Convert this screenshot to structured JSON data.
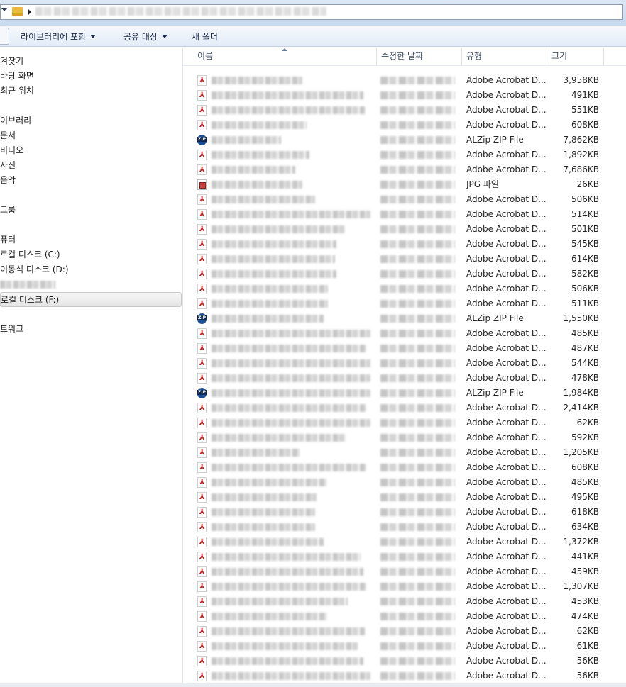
{
  "addressbar": {
    "icon": "folder-icon"
  },
  "toolbar": {
    "include_in_library": "라이브러리에 포함",
    "share_with": "공유 대상",
    "new_folder": "새 폴더"
  },
  "nav": {
    "items": [
      {
        "label": "겨찾기",
        "top": 0
      },
      {
        "label": "바탕 화면",
        "top": 0
      },
      {
        "label": "최근 위치",
        "top": 0
      },
      {
        "label": "이브러리",
        "top": 0
      },
      {
        "label": "문서",
        "top": 0
      },
      {
        "label": "비디오",
        "top": 0
      },
      {
        "label": "사진",
        "top": 0
      },
      {
        "label": "음악",
        "top": 0
      },
      {
        "label": "그룹",
        "top": 0
      },
      {
        "label": "퓨터",
        "top": 0
      },
      {
        "label": "로컬 디스크 (C:)",
        "top": 0
      },
      {
        "label": "이동식 디스크 (D:)",
        "top": 0
      },
      {
        "label": "",
        "top": 0
      },
      {
        "label": "로컬 디스크 (F:)",
        "top": 0
      },
      {
        "label": "트워크",
        "top": 0
      }
    ]
  },
  "columns": {
    "name": "이름",
    "date": "수정한 날짜",
    "type": "유형",
    "size": "크기"
  },
  "files": [
    {
      "icon": "pdf",
      "type": "Adobe Acrobat D...",
      "size": "3,958KB"
    },
    {
      "icon": "pdf",
      "type": "Adobe Acrobat D...",
      "size": "491KB"
    },
    {
      "icon": "pdf",
      "type": "Adobe Acrobat D...",
      "size": "551KB"
    },
    {
      "icon": "pdf",
      "type": "Adobe Acrobat D...",
      "size": "608KB"
    },
    {
      "icon": "zip",
      "type": "ALZip ZIP File",
      "size": "7,862KB"
    },
    {
      "icon": "pdf",
      "type": "Adobe Acrobat D...",
      "size": "1,892KB"
    },
    {
      "icon": "pdf",
      "type": "Adobe Acrobat D...",
      "size": "7,686KB"
    },
    {
      "icon": "jpg",
      "type": "JPG 파일",
      "size": "26KB"
    },
    {
      "icon": "pdf",
      "type": "Adobe Acrobat D...",
      "size": "506KB"
    },
    {
      "icon": "pdf",
      "type": "Adobe Acrobat D...",
      "size": "514KB"
    },
    {
      "icon": "pdf",
      "type": "Adobe Acrobat D...",
      "size": "501KB"
    },
    {
      "icon": "pdf",
      "type": "Adobe Acrobat D...",
      "size": "545KB"
    },
    {
      "icon": "pdf",
      "type": "Adobe Acrobat D...",
      "size": "614KB"
    },
    {
      "icon": "pdf",
      "type": "Adobe Acrobat D...",
      "size": "582KB"
    },
    {
      "icon": "pdf",
      "type": "Adobe Acrobat D...",
      "size": "506KB"
    },
    {
      "icon": "pdf",
      "type": "Adobe Acrobat D...",
      "size": "511KB"
    },
    {
      "icon": "zip",
      "type": "ALZip ZIP File",
      "size": "1,550KB"
    },
    {
      "icon": "pdf",
      "type": "Adobe Acrobat D...",
      "size": "485KB"
    },
    {
      "icon": "pdf",
      "type": "Adobe Acrobat D...",
      "size": "487KB"
    },
    {
      "icon": "pdf",
      "type": "Adobe Acrobat D...",
      "size": "544KB"
    },
    {
      "icon": "pdf",
      "type": "Adobe Acrobat D...",
      "size": "478KB"
    },
    {
      "icon": "zip",
      "type": "ALZip ZIP File",
      "size": "1,984KB"
    },
    {
      "icon": "pdf",
      "type": "Adobe Acrobat D...",
      "size": "2,414KB"
    },
    {
      "icon": "pdf",
      "type": "Adobe Acrobat D...",
      "size": "62KB"
    },
    {
      "icon": "pdf",
      "type": "Adobe Acrobat D...",
      "size": "592KB"
    },
    {
      "icon": "pdf",
      "type": "Adobe Acrobat D...",
      "size": "1,205KB"
    },
    {
      "icon": "pdf",
      "type": "Adobe Acrobat D...",
      "size": "608KB"
    },
    {
      "icon": "pdf",
      "type": "Adobe Acrobat D...",
      "size": "485KB"
    },
    {
      "icon": "pdf",
      "type": "Adobe Acrobat D...",
      "size": "495KB"
    },
    {
      "icon": "pdf",
      "type": "Adobe Acrobat D...",
      "size": "618KB"
    },
    {
      "icon": "pdf",
      "type": "Adobe Acrobat D...",
      "size": "634KB"
    },
    {
      "icon": "pdf",
      "type": "Adobe Acrobat D...",
      "size": "1,372KB"
    },
    {
      "icon": "pdf",
      "type": "Adobe Acrobat D...",
      "size": "441KB"
    },
    {
      "icon": "pdf",
      "type": "Adobe Acrobat D...",
      "size": "459KB"
    },
    {
      "icon": "pdf",
      "type": "Adobe Acrobat D...",
      "size": "1,307KB"
    },
    {
      "icon": "pdf",
      "type": "Adobe Acrobat D...",
      "size": "453KB"
    },
    {
      "icon": "pdf",
      "type": "Adobe Acrobat D...",
      "size": "474KB"
    },
    {
      "icon": "pdf",
      "type": "Adobe Acrobat D...",
      "size": "62KB"
    },
    {
      "icon": "pdf",
      "type": "Adobe Acrobat D...",
      "size": "61KB"
    },
    {
      "icon": "pdf",
      "type": "Adobe Acrobat D...",
      "size": "56KB"
    },
    {
      "icon": "pdf",
      "type": "Adobe Acrobat D...",
      "size": "56KB"
    }
  ]
}
